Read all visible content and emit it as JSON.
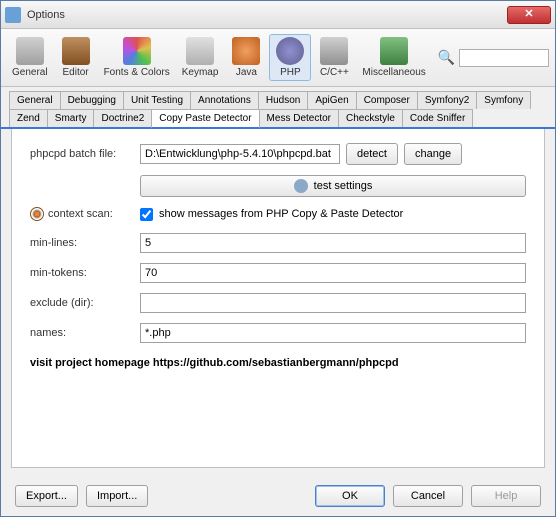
{
  "window": {
    "title": "Options"
  },
  "toolbar": {
    "items": [
      {
        "label": "General"
      },
      {
        "label": "Editor"
      },
      {
        "label": "Fonts & Colors"
      },
      {
        "label": "Keymap"
      },
      {
        "label": "Java"
      },
      {
        "label": "PHP"
      },
      {
        "label": "C/C++"
      },
      {
        "label": "Miscellaneous"
      }
    ],
    "search_placeholder": ""
  },
  "tabs_top": [
    "General",
    "Debugging",
    "Unit Testing",
    "Annotations",
    "Hudson",
    "ApiGen",
    "Composer",
    "Symfony2",
    "Symfony"
  ],
  "tabs_sub": [
    "Zend",
    "Smarty",
    "Doctrine2",
    "Copy Paste Detector",
    "Mess Detector",
    "Checkstyle",
    "Code Sniffer"
  ],
  "form": {
    "batch_label": "phpcpd batch file:",
    "batch_value": "D:\\Entwicklung\\php-5.4.10\\phpcpd.bat",
    "detect": "detect",
    "change": "change",
    "test_settings": "test settings",
    "context_label": "context scan:",
    "context_check": "show messages from PHP Copy & Paste Detector",
    "min_lines_label": "min-lines:",
    "min_lines_value": "5",
    "min_tokens_label": "min-tokens:",
    "min_tokens_value": "70",
    "exclude_label": "exclude (dir):",
    "exclude_value": "",
    "names_label": "names:",
    "names_value": "*.php",
    "homepage": "visit project homepage https://github.com/sebastianbergmann/phpcpd"
  },
  "footer": {
    "export": "Export...",
    "import": "Import...",
    "ok": "OK",
    "cancel": "Cancel",
    "help": "Help"
  }
}
